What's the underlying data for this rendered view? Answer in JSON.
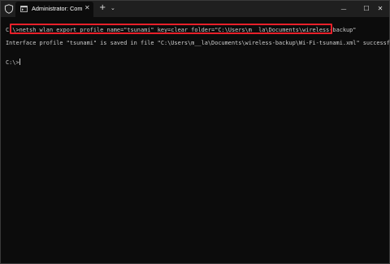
{
  "titlebar": {
    "tab_title": "Administrator: Command Prompt",
    "tab_close": "✕",
    "new_tab": "+",
    "dropdown": "⌄",
    "minimize": "—",
    "maximize": "☐",
    "close": "✕"
  },
  "terminal": {
    "prompt_1": "C:\\>",
    "command": "netsh wlan export profile name=\"tsunami\" key=clear folder=\"C:\\Users\\m__la\\Documents\\wireless-backup\"",
    "output": "Interface profile \"tsunami\" is saved in file \"C:\\Users\\m__la\\Documents\\wireless-backup\\Wi-Fi-tsunami.xml\" successfully.",
    "prompt_2": "C:\\>"
  },
  "colors": {
    "background": "#0c0c0c",
    "titlebar": "#1f1f1f",
    "text": "#cccccc",
    "highlight": "#e8202a"
  }
}
